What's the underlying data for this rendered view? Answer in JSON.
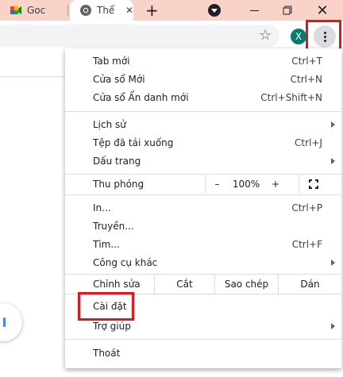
{
  "tabs": [
    {
      "title": "Goc",
      "favicon": "meet-icon"
    },
    {
      "title": "Thể",
      "favicon": "chrome-icon",
      "active": true
    }
  ],
  "toolbar": {
    "avatar_letter": "X",
    "new_tab_glyph": "+",
    "star_glyph": "☆"
  },
  "menu": {
    "group1": [
      {
        "label": "Tab mới",
        "shortcut": "Ctrl+T"
      },
      {
        "label": "Cửa sổ Mới",
        "shortcut": "Ctrl+N"
      },
      {
        "label": "Cửa sổ Ẩn danh mới",
        "shortcut": "Ctrl+Shift+N"
      }
    ],
    "group2": [
      {
        "label": "Lịch sử",
        "submenu": true
      },
      {
        "label": "Tệp đã tải xuống",
        "shortcut": "Ctrl+J"
      },
      {
        "label": "Dấu trang",
        "submenu": true
      }
    ],
    "zoom": {
      "label": "Thu phóng",
      "minus": "–",
      "value": "100%",
      "plus": "+"
    },
    "group3": [
      {
        "label": "In...",
        "shortcut": "Ctrl+P"
      },
      {
        "label": "Truyền..."
      },
      {
        "label": "Tìm...",
        "shortcut": "Ctrl+F"
      },
      {
        "label": "Công cụ khác",
        "submenu": true
      }
    ],
    "edit": {
      "label": "Chỉnh sửa",
      "cut": "Cắt",
      "copy": "Sao chép",
      "paste": "Dán"
    },
    "group4": [
      {
        "label": "Cài đặt"
      },
      {
        "label": "Trợ giúp",
        "submenu": true
      }
    ],
    "exit": {
      "label": "Thoát"
    }
  },
  "colors": {
    "highlight": "#e3141b",
    "tabstrip": "#f9d3c8",
    "avatar": "#0b7a6e"
  }
}
